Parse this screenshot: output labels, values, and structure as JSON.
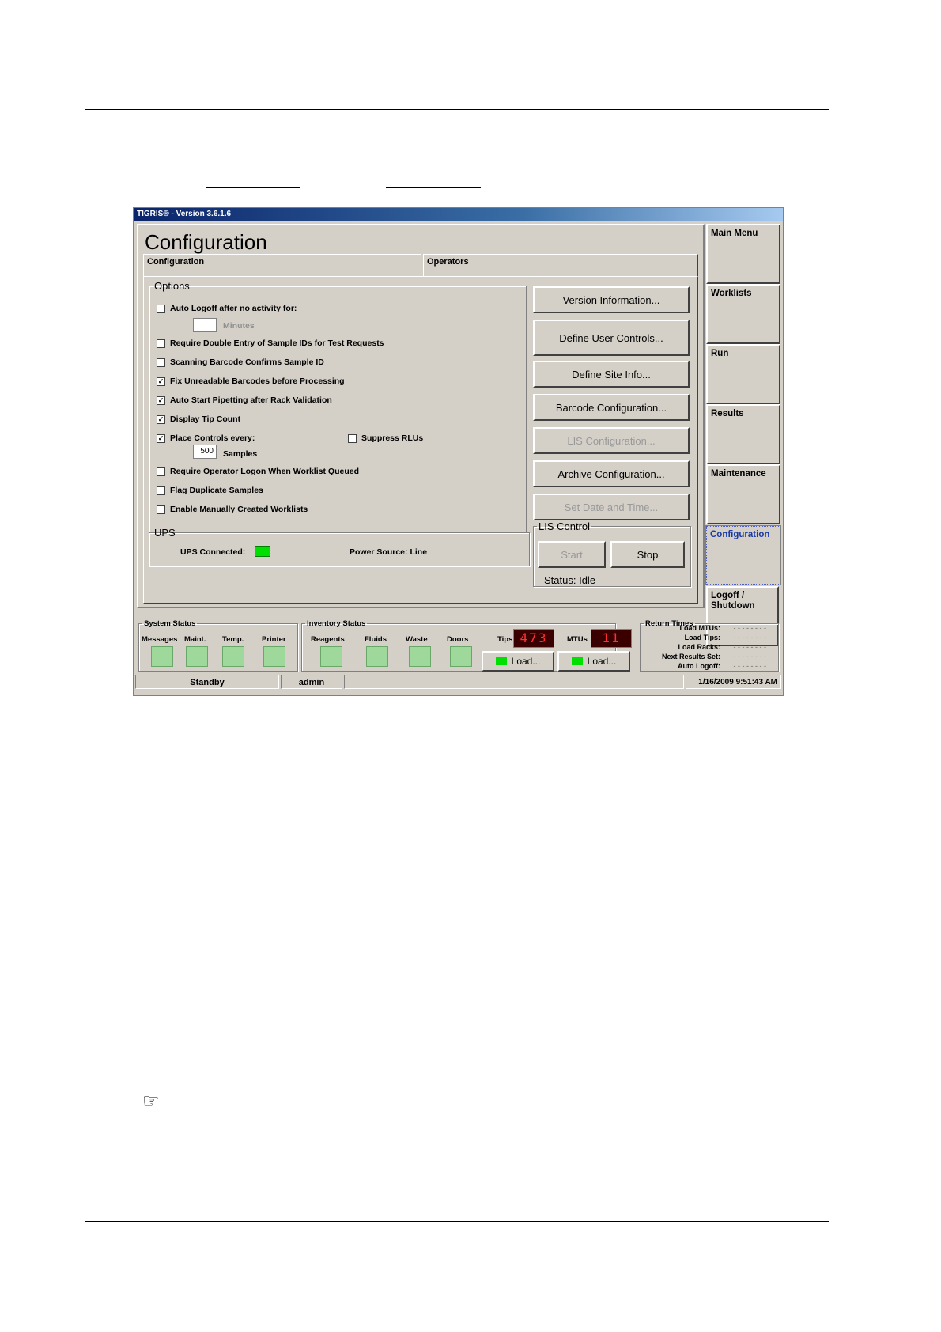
{
  "window": {
    "title": "TIGRIS® - Version 3.6.1.6"
  },
  "page_title": "Configuration",
  "tabs": [
    {
      "label": "Configuration"
    },
    {
      "label": "Operators"
    }
  ],
  "options": {
    "legend": "Options",
    "auto_logoff": {
      "label": "Auto Logoff after no activity for:",
      "checked": "",
      "value": "",
      "unit": "Minutes"
    },
    "double_entry": {
      "label": "Require Double Entry of Sample IDs for Test Requests",
      "checked": ""
    },
    "scan_confirms": {
      "label": "Scanning Barcode Confirms Sample ID",
      "checked": ""
    },
    "fix_unreadable": {
      "label": "Fix Unreadable Barcodes before Processing",
      "checked": "✓"
    },
    "auto_start": {
      "label": "Auto Start Pipetting after Rack Validation",
      "checked": "✓"
    },
    "tip_count": {
      "label": "Display Tip Count",
      "checked": "✓"
    },
    "place_controls": {
      "label": "Place Controls every:",
      "checked": "✓",
      "value": "500",
      "unit": "Samples"
    },
    "suppress_rlus": {
      "label": "Suppress RLUs",
      "checked": ""
    },
    "require_logon": {
      "label": "Require Operator Logon When Worklist Queued",
      "checked": ""
    },
    "flag_duplicate": {
      "label": "Flag Duplicate Samples",
      "checked": ""
    },
    "manual_worklists": {
      "label": "Enable Manually Created Worklists",
      "checked": ""
    }
  },
  "ups": {
    "legend": "UPS",
    "connected_label": "UPS Connected:",
    "power_source_label": "Power Source:",
    "power_source_value": "Line",
    "connected_color": "#00e000"
  },
  "buttons": {
    "version_info": "Version Information...",
    "define_user_controls": "Define User Controls...",
    "define_site_info": "Define Site Info...",
    "barcode_config": "Barcode Configuration...",
    "lis_config": "LIS Configuration...",
    "archive_config": "Archive Configuration...",
    "set_date_time": "Set Date and Time..."
  },
  "lis_control": {
    "legend": "LIS Control",
    "start": "Start",
    "stop": "Stop",
    "status_label": "Status:",
    "status_value": "Idle"
  },
  "nav": [
    {
      "label": "Main Menu"
    },
    {
      "label": "Worklists"
    },
    {
      "label": "Run"
    },
    {
      "label": "Results"
    },
    {
      "label": "Maintenance"
    },
    {
      "label": "Configuration"
    },
    {
      "label": "Logoff / Shutdown"
    }
  ],
  "system_status": {
    "legend": "System Status",
    "items": [
      "Messages",
      "Maint.",
      "Temp.",
      "Printer"
    ]
  },
  "inventory_status": {
    "legend": "Inventory Status",
    "items": [
      "Reagents",
      "Fluids",
      "Waste",
      "Doors"
    ],
    "tips_label": "Tips",
    "tips_value": "473",
    "mtus_label": "MTUs",
    "mtus_value": "11",
    "load_label": "Load..."
  },
  "return_times": {
    "legend": "Return Times",
    "rows": [
      {
        "label": "Load MTUs:",
        "value": "- - - - - - - -"
      },
      {
        "label": "Load Tips:",
        "value": "- - - - - - - -"
      },
      {
        "label": "Load Racks:",
        "value": "- - - - - - - -"
      },
      {
        "label": "Next Results Set:",
        "value": "- - - - - - - -"
      },
      {
        "label": "Auto Logoff:",
        "value": "- - - - - - - -"
      }
    ]
  },
  "status_bar": {
    "state": "Standby",
    "user": "admin",
    "datetime": "1/16/2009 9:51:43 AM"
  },
  "note_icon": "pointing-hand-icon"
}
